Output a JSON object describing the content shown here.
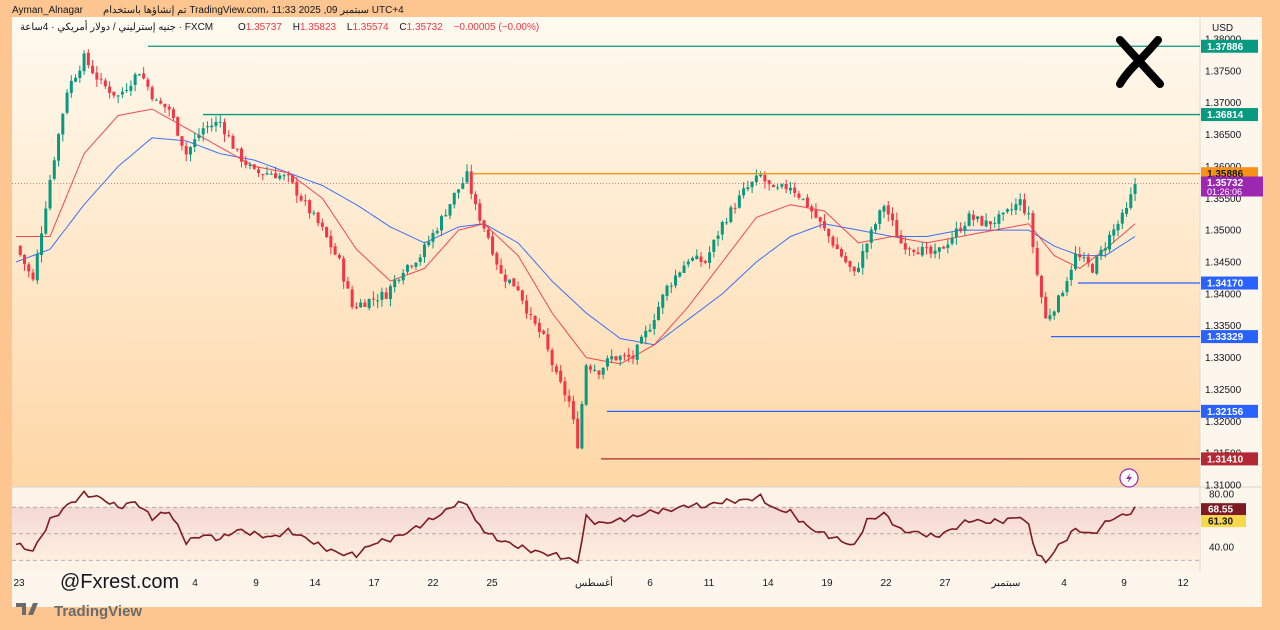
{
  "header": {
    "author": "Ayman_Alnagar",
    "published": "تم إنشاؤها باستخدام TradingView.com، 11:33 2025 ,09 سبتمبر UTC+4",
    "symbol": "جنيه إسترليني / دولار أمريكي · 4ساعة · FXCM",
    "open_label": "O",
    "open": "1.35737",
    "high_label": "H",
    "high": "1.35823",
    "low_label": "L",
    "low": "1.35574",
    "close_label": "C",
    "close": "1.35732",
    "change": "−0.00005 (−0.00%)"
  },
  "currency": "USD",
  "watermark": "@Fxrest.com",
  "footer_logo": "TradingView",
  "colors": {
    "up": "#089981",
    "down": "#f23645",
    "ma_fast": "#f23645",
    "ma_slow": "#2962ff",
    "level_teal": "#089981",
    "level_blue": "#2962ff",
    "level_red": "#b22833",
    "level_orange": "#f7931a",
    "price_tag": "#9c27b0",
    "rsi_line": "#7e1a24"
  },
  "chart_data": {
    "type": "candlestick",
    "timeframe": "4h",
    "ylim": [
      1.31,
      1.38
    ],
    "y_ticks": [
      "1.38000",
      "1.37500",
      "1.37000",
      "1.36500",
      "1.36000",
      "1.35500",
      "1.35000",
      "1.34500",
      "1.34000",
      "1.33500",
      "1.33000",
      "1.32500",
      "1.32000",
      "1.31500",
      "1.31000"
    ],
    "x_ticks": [
      "23",
      "4",
      "9",
      "14",
      "17",
      "22",
      "25",
      "أغسطس",
      "6",
      "11",
      "14",
      "19",
      "22",
      "27",
      "سبتمبر",
      "4",
      "9",
      "12"
    ],
    "price_path": [
      [
        0,
        1.3475
      ],
      [
        4,
        1.342
      ],
      [
        8,
        1.358
      ],
      [
        12,
        1.372
      ],
      [
        16,
        1.377
      ],
      [
        20,
        1.373
      ],
      [
        24,
        1.371
      ],
      [
        29,
        1.375
      ],
      [
        33,
        1.37
      ],
      [
        36,
        1.369
      ],
      [
        40,
        1.362
      ],
      [
        44,
        1.366
      ],
      [
        48,
        1.367
      ],
      [
        52,
        1.362
      ],
      [
        56,
        1.359
      ],
      [
        60,
        1.359
      ],
      [
        64,
        1.358
      ],
      [
        68,
        1.354
      ],
      [
        72,
        1.35
      ],
      [
        76,
        1.345
      ],
      [
        79,
        1.338
      ],
      [
        83,
        1.339
      ],
      [
        87,
        1.34
      ],
      [
        91,
        1.344
      ],
      [
        95,
        1.346
      ],
      [
        99,
        1.3505
      ],
      [
        103,
        1.3555
      ],
      [
        106,
        1.3585
      ],
      [
        108,
        1.3535
      ],
      [
        111,
        1.349
      ],
      [
        114,
        1.343
      ],
      [
        118,
        1.341
      ],
      [
        121,
        1.336
      ],
      [
        124,
        1.333
      ],
      [
        127,
        1.327
      ],
      [
        130,
        1.323
      ],
      [
        132,
        1.3165
      ],
      [
        134,
        1.329
      ],
      [
        137,
        1.328
      ],
      [
        140,
        1.33
      ],
      [
        145,
        1.33
      ],
      [
        149,
        1.335
      ],
      [
        153,
        1.341
      ],
      [
        158,
        1.3455
      ],
      [
        162,
        1.345
      ],
      [
        166,
        1.351
      ],
      [
        171,
        1.356
      ],
      [
        175,
        1.3585
      ],
      [
        178,
        1.356
      ],
      [
        182,
        1.357
      ],
      [
        186,
        1.354
      ],
      [
        190,
        1.35
      ],
      [
        194,
        1.346
      ],
      [
        197,
        1.343
      ],
      [
        200,
        1.348
      ],
      [
        204,
        1.354
      ],
      [
        208,
        1.348
      ],
      [
        212,
        1.347
      ],
      [
        216,
        1.346
      ],
      [
        220,
        1.349
      ],
      [
        224,
        1.352
      ],
      [
        228,
        1.351
      ],
      [
        232,
        1.352
      ],
      [
        236,
        1.3545
      ],
      [
        238,
        1.352
      ],
      [
        240,
        1.343
      ],
      [
        242,
        1.336
      ],
      [
        245,
        1.339
      ],
      [
        249,
        1.346
      ],
      [
        253,
        1.344
      ],
      [
        257,
        1.349
      ],
      [
        261,
        1.353
      ],
      [
        263,
        1.3573
      ]
    ],
    "ma_fast_path": [
      [
        0,
        1.349
      ],
      [
        8,
        1.349
      ],
      [
        16,
        1.362
      ],
      [
        24,
        1.368
      ],
      [
        32,
        1.369
      ],
      [
        40,
        1.366
      ],
      [
        48,
        1.363
      ],
      [
        56,
        1.36
      ],
      [
        64,
        1.359
      ],
      [
        72,
        1.355
      ],
      [
        80,
        1.347
      ],
      [
        88,
        1.342
      ],
      [
        96,
        1.344
      ],
      [
        104,
        1.35
      ],
      [
        110,
        1.351
      ],
      [
        118,
        1.346
      ],
      [
        126,
        1.337
      ],
      [
        134,
        1.33
      ],
      [
        142,
        1.329
      ],
      [
        150,
        1.332
      ],
      [
        158,
        1.338
      ],
      [
        166,
        1.345
      ],
      [
        174,
        1.352
      ],
      [
        182,
        1.354
      ],
      [
        190,
        1.353
      ],
      [
        198,
        1.348
      ],
      [
        206,
        1.349
      ],
      [
        214,
        1.348
      ],
      [
        222,
        1.349
      ],
      [
        230,
        1.35
      ],
      [
        238,
        1.351
      ],
      [
        244,
        1.346
      ],
      [
        250,
        1.344
      ],
      [
        256,
        1.347
      ],
      [
        263,
        1.351
      ]
    ],
    "ma_slow_path": [
      [
        0,
        1.345
      ],
      [
        8,
        1.347
      ],
      [
        16,
        1.354
      ],
      [
        24,
        1.36
      ],
      [
        32,
        1.3645
      ],
      [
        40,
        1.364
      ],
      [
        48,
        1.362
      ],
      [
        56,
        1.361
      ],
      [
        64,
        1.359
      ],
      [
        72,
        1.357
      ],
      [
        80,
        1.354
      ],
      [
        88,
        1.3505
      ],
      [
        96,
        1.348
      ],
      [
        104,
        1.3505
      ],
      [
        110,
        1.351
      ],
      [
        118,
        1.348
      ],
      [
        126,
        1.342
      ],
      [
        134,
        1.337
      ],
      [
        142,
        1.333
      ],
      [
        150,
        1.332
      ],
      [
        158,
        1.336
      ],
      [
        166,
        1.34
      ],
      [
        174,
        1.345
      ],
      [
        182,
        1.349
      ],
      [
        190,
        1.351
      ],
      [
        198,
        1.35
      ],
      [
        206,
        1.349
      ],
      [
        214,
        1.349
      ],
      [
        222,
        1.35
      ],
      [
        230,
        1.35
      ],
      [
        238,
        1.35
      ],
      [
        244,
        1.3475
      ],
      [
        250,
        1.346
      ],
      [
        256,
        1.346
      ],
      [
        263,
        1.349
      ]
    ],
    "levels": [
      {
        "value": 1.37886,
        "label": "1.37886",
        "style": "teal",
        "from": 148
      },
      {
        "value": 1.36814,
        "label": "1.36814",
        "style": "teal",
        "from": 203
      },
      {
        "value": 1.35886,
        "label": "1.35886",
        "style": "orange",
        "from": 473
      },
      {
        "value": 1.3417,
        "label": "1.34170",
        "style": "blue",
        "from": 1078
      },
      {
        "value": 1.33329,
        "label": "1.33329",
        "style": "blue",
        "from": 1051
      },
      {
        "value": 1.32156,
        "label": "1.32156",
        "style": "blue",
        "from": 607
      },
      {
        "value": 1.3141,
        "label": "1.31410",
        "style": "red",
        "from": 601
      }
    ],
    "current_price": {
      "value": 1.35732,
      "label": "1.35732",
      "countdown": "01:26:06"
    },
    "rsi": {
      "ylim": [
        20,
        90
      ],
      "ticks": [
        "80.00",
        "40.00"
      ],
      "value": "68.55",
      "ma_value": "61.30",
      "bands": [
        70,
        50,
        30
      ],
      "path": [
        [
          0,
          42
        ],
        [
          4,
          36
        ],
        [
          8,
          60
        ],
        [
          12,
          72
        ],
        [
          16,
          80
        ],
        [
          20,
          76
        ],
        [
          24,
          70
        ],
        [
          28,
          75
        ],
        [
          32,
          62
        ],
        [
          36,
          66
        ],
        [
          40,
          44
        ],
        [
          44,
          50
        ],
        [
          48,
          46
        ],
        [
          52,
          52
        ],
        [
          56,
          50
        ],
        [
          60,
          48
        ],
        [
          64,
          52
        ],
        [
          68,
          46
        ],
        [
          72,
          40
        ],
        [
          76,
          36
        ],
        [
          80,
          34
        ],
        [
          84,
          42
        ],
        [
          88,
          46
        ],
        [
          92,
          52
        ],
        [
          96,
          58
        ],
        [
          100,
          64
        ],
        [
          103,
          72
        ],
        [
          106,
          74
        ],
        [
          108,
          60
        ],
        [
          111,
          50
        ],
        [
          114,
          44
        ],
        [
          118,
          40
        ],
        [
          121,
          38
        ],
        [
          124,
          36
        ],
        [
          127,
          34
        ],
        [
          130,
          30
        ],
        [
          132,
          28
        ],
        [
          134,
          62
        ],
        [
          137,
          58
        ],
        [
          140,
          60
        ],
        [
          145,
          62
        ],
        [
          149,
          66
        ],
        [
          153,
          68
        ],
        [
          158,
          72
        ],
        [
          162,
          70
        ],
        [
          166,
          74
        ],
        [
          171,
          76
        ],
        [
          175,
          78
        ],
        [
          178,
          68
        ],
        [
          182,
          66
        ],
        [
          186,
          56
        ],
        [
          190,
          50
        ],
        [
          194,
          44
        ],
        [
          197,
          40
        ],
        [
          200,
          60
        ],
        [
          204,
          66
        ],
        [
          208,
          52
        ],
        [
          212,
          50
        ],
        [
          216,
          48
        ],
        [
          220,
          54
        ],
        [
          224,
          60
        ],
        [
          228,
          58
        ],
        [
          232,
          60
        ],
        [
          236,
          64
        ],
        [
          238,
          56
        ],
        [
          240,
          34
        ],
        [
          242,
          28
        ],
        [
          245,
          40
        ],
        [
          249,
          54
        ],
        [
          253,
          50
        ],
        [
          257,
          60
        ],
        [
          261,
          64
        ],
        [
          263,
          68.55
        ]
      ]
    }
  }
}
